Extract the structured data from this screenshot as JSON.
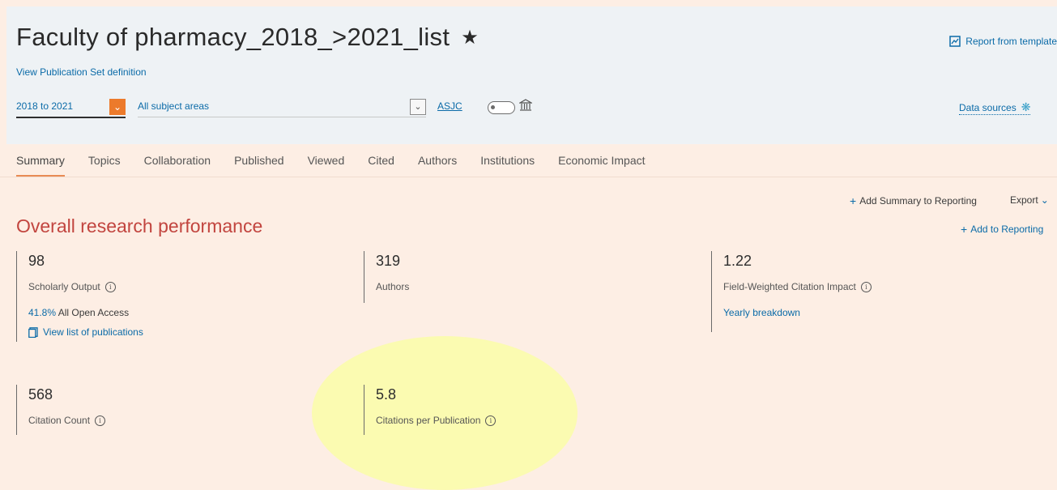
{
  "header": {
    "title": "Faculty of pharmacy_2018_>2021_list",
    "view_definition_link": "View Publication Set definition",
    "report_from_template": "Report from template",
    "year_range": "2018 to 2021",
    "subject_areas": "All subject areas",
    "asjc_label": "ASJC",
    "data_sources": "Data sources"
  },
  "tabs": [
    {
      "label": "Summary",
      "active": true
    },
    {
      "label": "Topics"
    },
    {
      "label": "Collaboration"
    },
    {
      "label": "Published"
    },
    {
      "label": "Viewed"
    },
    {
      "label": "Cited"
    },
    {
      "label": "Authors"
    },
    {
      "label": "Institutions"
    },
    {
      "label": "Economic Impact"
    }
  ],
  "actions": {
    "add_summary": "Add Summary to Reporting",
    "export": "Export",
    "add_to_reporting": "Add to Reporting"
  },
  "section": {
    "title": "Overall research performance"
  },
  "metrics": {
    "scholarly_output": {
      "value": "98",
      "label": "Scholarly Output",
      "oa_pct": "41.8%",
      "oa_label": "All Open Access",
      "view_list": "View list of publications"
    },
    "authors": {
      "value": "319",
      "label": "Authors"
    },
    "fwci": {
      "value": "1.22",
      "label": "Field-Weighted Citation Impact",
      "yearly": "Yearly breakdown"
    },
    "citation_count": {
      "value": "568",
      "label": "Citation Count"
    },
    "citations_per_pub": {
      "value": "5.8",
      "label": "Citations per Publication"
    }
  },
  "colors": {
    "accent_orange": "#ec7a2b",
    "link_blue": "#0b6ba8",
    "section_red": "#c2453f",
    "highlight_yellow": "#fbfbae"
  }
}
